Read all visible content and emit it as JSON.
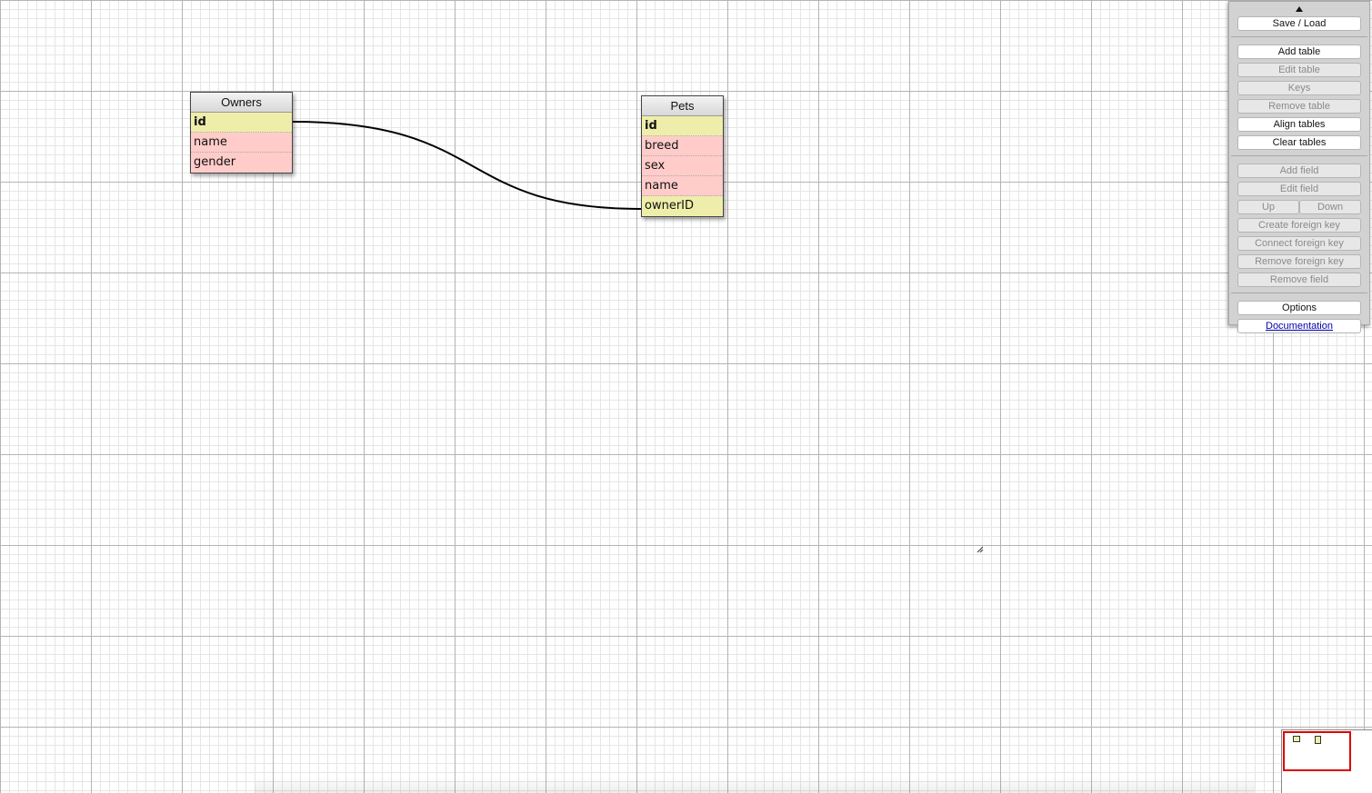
{
  "tables": [
    {
      "id": "owners",
      "title": "Owners",
      "fields": [
        {
          "name": "id",
          "kind": "primary"
        },
        {
          "name": "name",
          "kind": "plain"
        },
        {
          "name": "gender",
          "kind": "plain"
        }
      ]
    },
    {
      "id": "pets",
      "title": "Pets",
      "fields": [
        {
          "name": "id",
          "kind": "primary"
        },
        {
          "name": "breed",
          "kind": "plain"
        },
        {
          "name": "sex",
          "kind": "plain"
        },
        {
          "name": "name",
          "kind": "plain"
        },
        {
          "name": "ownerID",
          "kind": "foreign"
        }
      ]
    }
  ],
  "relations": [
    {
      "from": "Owners.id",
      "to": "Pets.ownerID"
    }
  ],
  "toolbar": {
    "collapse_icon": "triangle-up-icon",
    "save_load": "Save / Load",
    "add_table": "Add table",
    "edit_table": "Edit table",
    "keys": "Keys",
    "remove_table": "Remove table",
    "align_tables": "Align tables",
    "clear_tables": "Clear tables",
    "add_field": "Add field",
    "edit_field": "Edit field",
    "up": "Up",
    "down": "Down",
    "create_foreign_key": "Create foreign key",
    "connect_foreign_key": "Connect foreign key",
    "remove_foreign_key": "Remove foreign key",
    "remove_field": "Remove field",
    "options": "Options",
    "documentation": "Documentation"
  },
  "colors": {
    "key_field": "#eeeeaa",
    "plain_field": "#ffccca",
    "minimap_viewport": "#dd0000"
  }
}
